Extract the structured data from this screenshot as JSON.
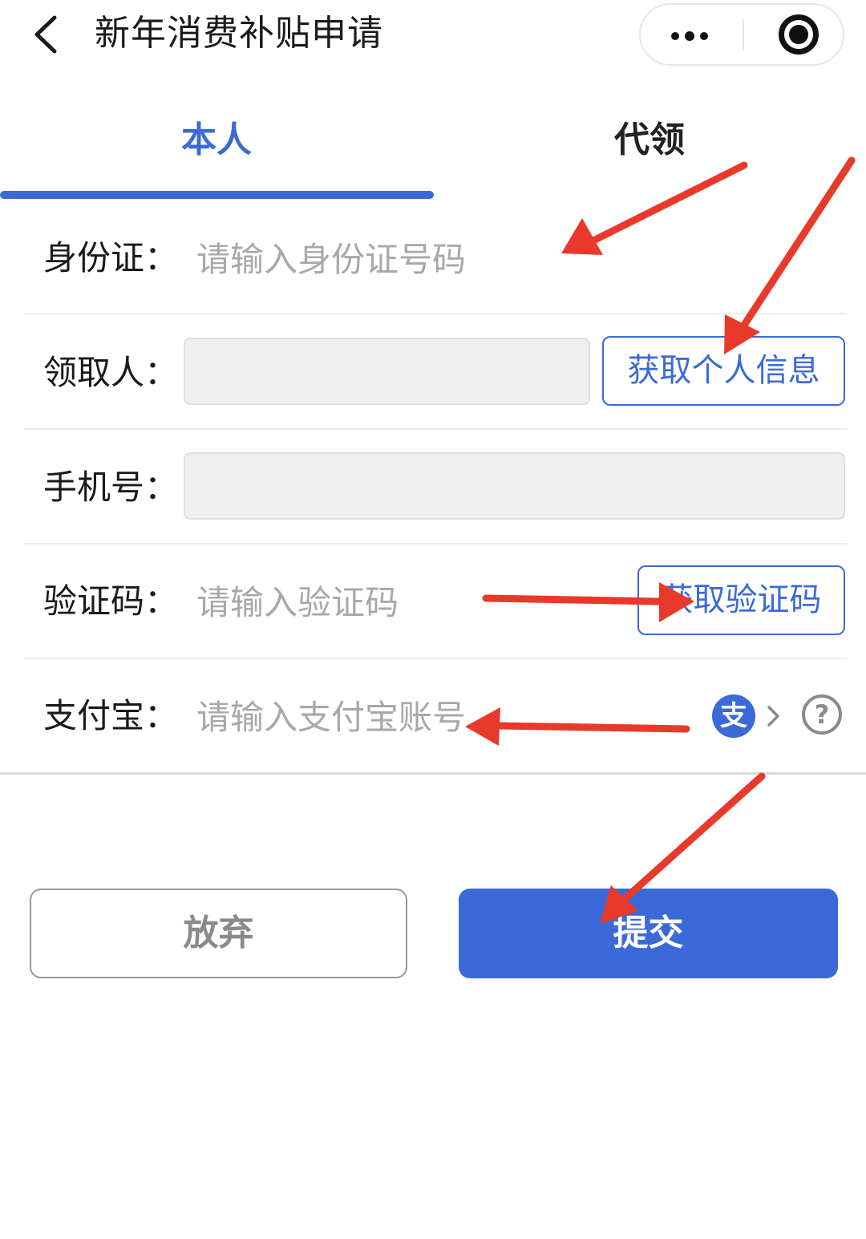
{
  "header": {
    "title": "新年消费补贴申请",
    "back_icon": "chevron-left-icon",
    "more_icon": "more-dots-icon",
    "close_icon": "target-close-icon"
  },
  "tabs": [
    {
      "label": "本人",
      "active": true
    },
    {
      "label": "代领",
      "active": false
    }
  ],
  "form": {
    "id_card": {
      "label": "身份证：",
      "placeholder": "请输入身份证号码",
      "value": ""
    },
    "recipient": {
      "label": "领取人：",
      "value": "",
      "button": "获取个人信息"
    },
    "phone": {
      "label": "手机号：",
      "value": ""
    },
    "code": {
      "label": "验证码：",
      "placeholder": "请输入验证码",
      "value": "",
      "button": "获取验证码"
    },
    "alipay": {
      "label": "支付宝：",
      "placeholder": "请输入支付宝账号",
      "value": "",
      "icon": "alipay-icon",
      "icon_glyph": "支",
      "help_icon": "help-icon",
      "help_glyph": "?"
    }
  },
  "actions": {
    "abandon": "放弃",
    "submit": "提交"
  },
  "colors": {
    "accent": "#3b6ad8",
    "annotation_arrow": "#e8392b"
  }
}
